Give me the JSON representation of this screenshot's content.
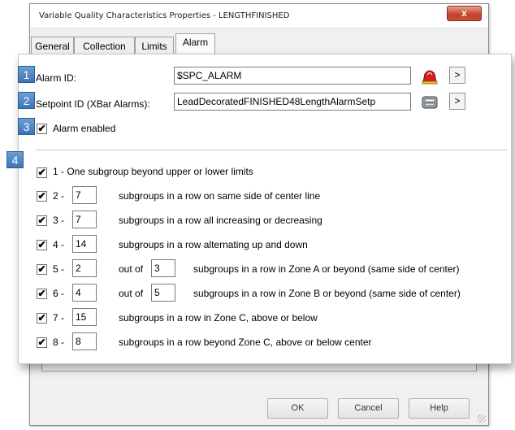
{
  "window": {
    "title": "Variable Quality Characteristics Properties - LENGTHFINISHED",
    "close_glyph": "x"
  },
  "tabs": [
    {
      "label": "General",
      "active": false
    },
    {
      "label": "Collection",
      "active": false
    },
    {
      "label": "Limits",
      "active": false
    },
    {
      "label": "Alarm",
      "active": true
    }
  ],
  "badges": [
    "1",
    "2",
    "3",
    "4"
  ],
  "alarm_id": {
    "label": "Alarm ID:",
    "value": "$SPC_ALARM",
    "icon": "alarm-bell-icon",
    "arrow": ">"
  },
  "setpoint_id": {
    "label": "Setpoint ID (XBar Alarms):",
    "value": "LeadDecoratedFINISHED48LengthAlarmSetp",
    "icon": "tag-browse-icon",
    "arrow": ">"
  },
  "alarm_enabled": {
    "label": "Alarm enabled",
    "checked": true
  },
  "rules": [
    {
      "prefix": "1 - One subgroup beyond upper or lower limits",
      "checked": true
    },
    {
      "prefix": "2 -",
      "value": "7",
      "text": "subgroups in a row on same side of center line",
      "checked": true
    },
    {
      "prefix": "3 -",
      "value": "7",
      "text": "subgroups in a row all increasing or decreasing",
      "checked": true
    },
    {
      "prefix": "4 -",
      "value": "14",
      "text": "subgroups in a row alternating up and down",
      "checked": true
    },
    {
      "prefix": "5 -",
      "value": "2",
      "mid": "out of",
      "value2": "3",
      "text": "subgroups in a row in Zone A or beyond (same side of center)",
      "checked": true
    },
    {
      "prefix": "6 -",
      "value": "4",
      "mid": "out of",
      "value2": "5",
      "text": "subgroups in a row in Zone B or beyond (same side of center)",
      "checked": true
    },
    {
      "prefix": "7 -",
      "value": "15",
      "text": "subgroups in a row in Zone C, above or below",
      "checked": true
    },
    {
      "prefix": "8 -",
      "value": "8",
      "text": "subgroups in a row beyond Zone C, above or below center",
      "checked": true
    }
  ],
  "check_glyph": "✔",
  "buttons": {
    "ok": "OK",
    "cancel": "Cancel",
    "help": "Help"
  }
}
